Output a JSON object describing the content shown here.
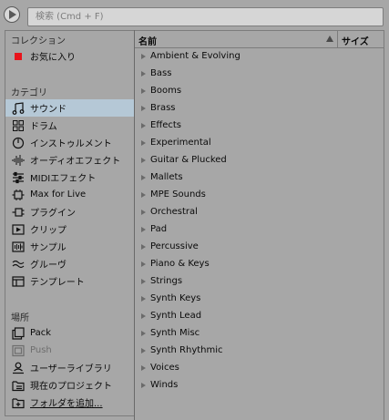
{
  "search": {
    "placeholder": "検索 (Cmd + F)"
  },
  "sidebar": {
    "collections_heading": "コレクション",
    "collections": [
      {
        "label": "お気に入り",
        "icon": "red-square-icon",
        "color": "#e8141b"
      }
    ],
    "categories_heading": "カテゴリ",
    "categories": [
      {
        "label": "サウンド",
        "icon": "music-note-icon",
        "selected": true
      },
      {
        "label": "ドラム",
        "icon": "drum-grid-icon"
      },
      {
        "label": "インストゥルメント",
        "icon": "clock-dial-icon"
      },
      {
        "label": "オーディオエフェクト",
        "icon": "audio-wave-icon"
      },
      {
        "label": "MIDIエフェクト",
        "icon": "midi-sliders-icon"
      },
      {
        "label": "Max for Live",
        "icon": "max-device-icon"
      },
      {
        "label": "プラグイン",
        "icon": "plug-icon"
      },
      {
        "label": "クリップ",
        "icon": "clip-play-icon"
      },
      {
        "label": "サンプル",
        "icon": "waveform-icon"
      },
      {
        "label": "グルーヴ",
        "icon": "groove-wave-icon"
      },
      {
        "label": "テンプレート",
        "icon": "template-icon"
      }
    ],
    "places_heading": "場所",
    "places": [
      {
        "label": "Pack",
        "icon": "pack-icon"
      },
      {
        "label": "Push",
        "icon": "push-icon",
        "dim": true
      },
      {
        "label": "ユーザーライブラリ",
        "icon": "user-library-icon"
      },
      {
        "label": "現在のプロジェクト",
        "icon": "project-folder-icon"
      },
      {
        "label": "フォルダを追加...",
        "icon": "add-folder-icon",
        "underline": true
      }
    ]
  },
  "list": {
    "header_name": "名前",
    "header_size": "サイズ",
    "items": [
      "Ambient & Evolving",
      "Bass",
      "Booms",
      "Brass",
      "Effects",
      "Experimental",
      "Guitar & Plucked",
      "Mallets",
      "MPE Sounds",
      "Orchestral",
      "Pad",
      "Percussive",
      "Piano & Keys",
      "Strings",
      "Synth Keys",
      "Synth Lead",
      "Synth Misc",
      "Synth Rhythmic",
      "Voices",
      "Winds"
    ]
  },
  "colors": {
    "background": "#a7a7a7",
    "selection": "#b5c8d6",
    "favorite": "#e8141b"
  }
}
